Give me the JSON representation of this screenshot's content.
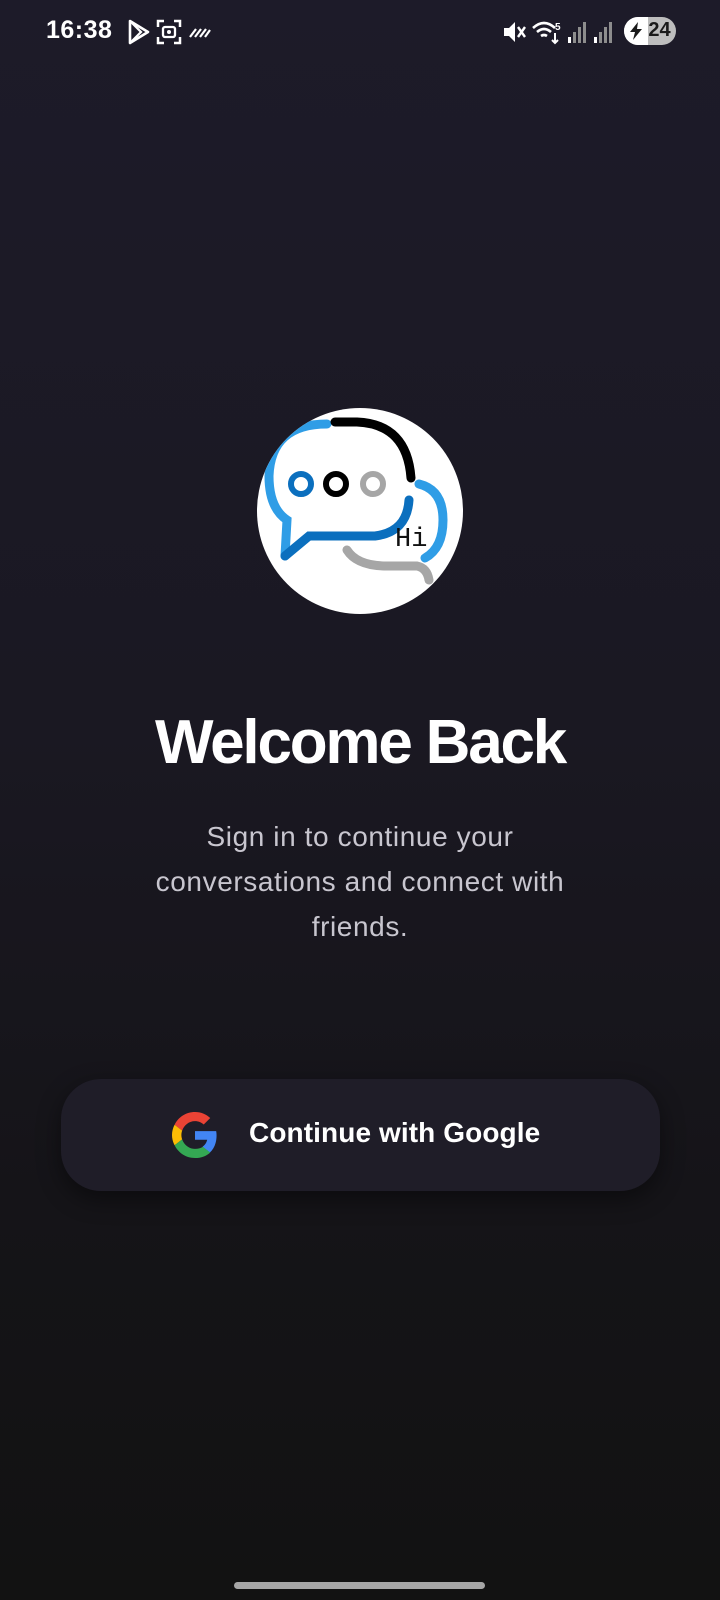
{
  "status_bar": {
    "time": "16:38",
    "battery_level": "24",
    "network_label": "5",
    "icons": [
      "play-store-icon",
      "screenshot-icon",
      "data-activity-icon",
      "vibrate-mute-icon",
      "wifi-icon",
      "signal-icon",
      "signal-icon",
      "battery-charging-icon"
    ]
  },
  "logo": {
    "text": "Hi",
    "colors": {
      "blue_light": "#2f9de6",
      "blue_dark": "#0b6fbe",
      "black": "#000000",
      "gray": "#a6a6a6"
    }
  },
  "welcome": {
    "title": "Welcome Back",
    "subtitle_line1": "Sign in to continue your",
    "subtitle_line2": "conversations and connect with",
    "subtitle_line3": "friends."
  },
  "auth": {
    "google_button_label": "Continue with Google",
    "google_colors": {
      "blue": "#4285F4",
      "red": "#EA4335",
      "yellow": "#FBBC05",
      "green": "#34A853"
    }
  }
}
